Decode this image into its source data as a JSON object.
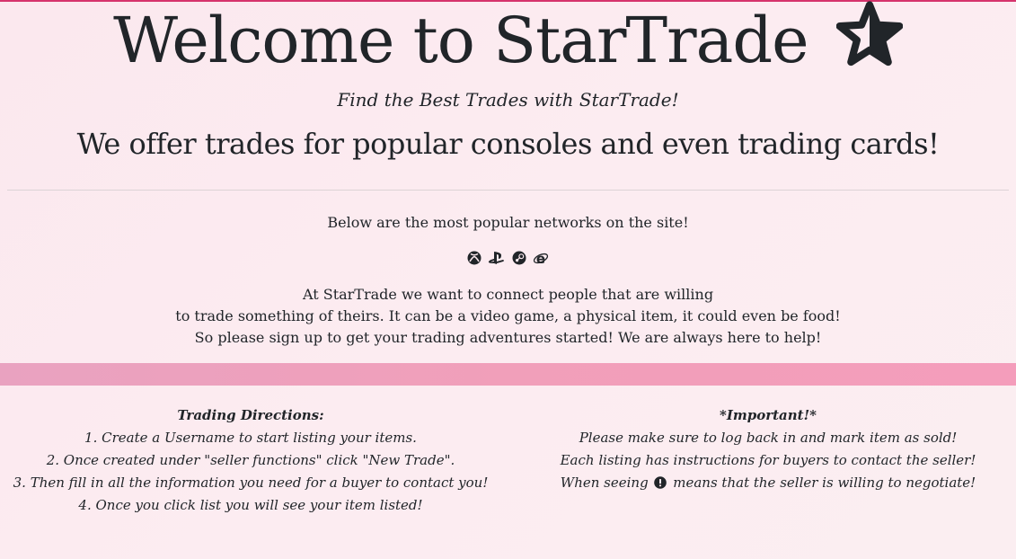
{
  "header": {
    "title": "Welcome to StarTrade",
    "title_icon": "star-icon",
    "tagline": "Find the Best Trades with StarTrade!",
    "offer": "We offer trades for popular consoles and even trading cards!"
  },
  "networks": {
    "intro": "Below are the most popular networks on the site!",
    "icons": [
      "xbox-icon",
      "playstation-icon",
      "steam-icon",
      "internet-explorer-icon"
    ]
  },
  "about": {
    "lines": [
      "At StarTrade we want to connect people that are willing",
      "to trade something of theirs. It can be a video game, a physical item, it could even be food!",
      "So please sign up to get your trading adventures started! We are always here to help!"
    ]
  },
  "directions": {
    "heading": "Trading Directions:",
    "steps": [
      "1. Create a Username to start listing your items.",
      "2. Once created under \"seller functions\" click \"New Trade\".",
      "3. Then fill in all the information you need for a buyer to contact you!",
      "4. Once you click list you will see your item listed!"
    ]
  },
  "important": {
    "heading": "*Important!*",
    "lines": [
      "Please make sure to log back in and mark item as sold!",
      "Each listing has instructions for buyers to contact the seller!"
    ],
    "negotiate_prefix": "When seeing",
    "negotiate_icon": "exclamation-circle-icon",
    "negotiate_suffix": "means that the seller is willing to negotiate!"
  },
  "colors": {
    "accent_band": "#f19fba",
    "top_line": "#d6336c",
    "text": "#212529"
  }
}
